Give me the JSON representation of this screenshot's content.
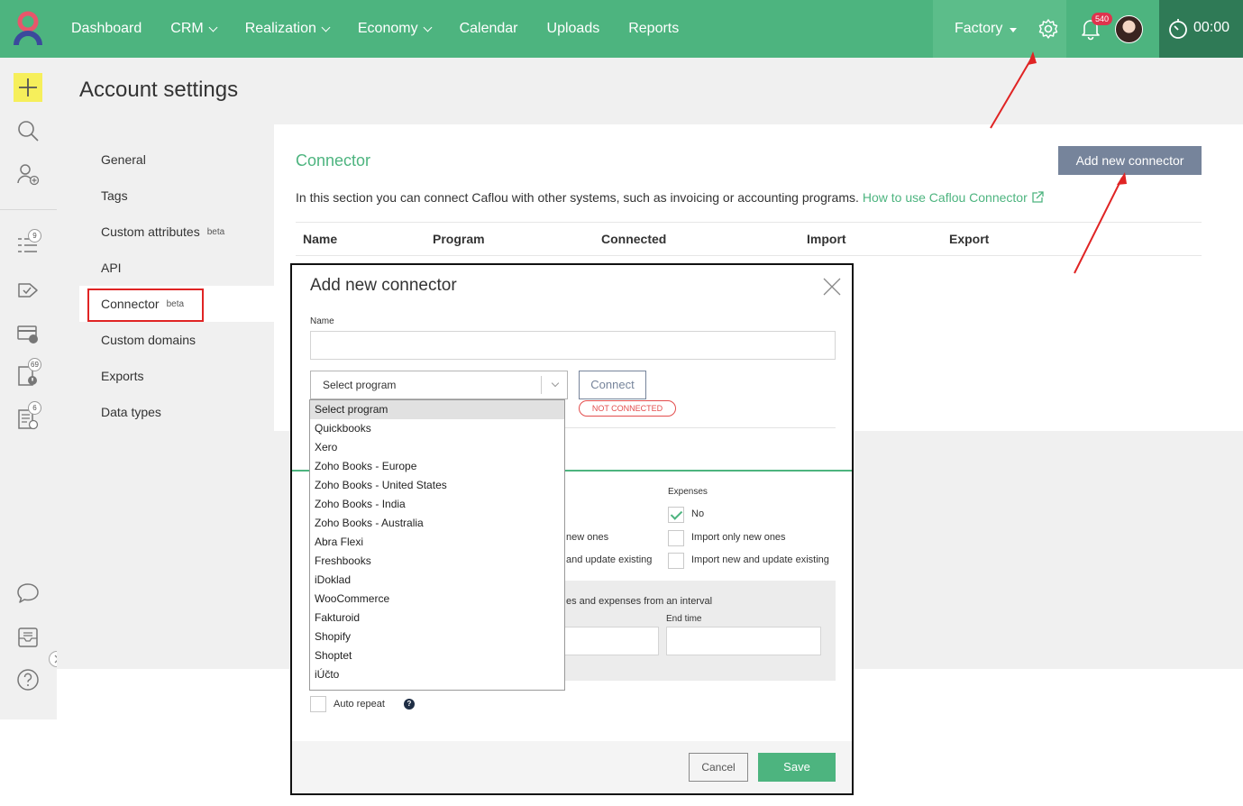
{
  "topbar": {
    "nav": [
      "Dashboard",
      "CRM",
      "Realization",
      "Economy",
      "Calendar",
      "Uploads",
      "Reports"
    ],
    "company": "Factory",
    "notifications": "540",
    "timer": "00:00"
  },
  "sidebar": {
    "badges": [
      "9",
      "69",
      "6"
    ]
  },
  "page": {
    "title": "Account settings"
  },
  "settings_nav": {
    "items": [
      {
        "label": "General"
      },
      {
        "label": "Tags"
      },
      {
        "label": "Custom attributes",
        "tag": "beta"
      },
      {
        "label": "API"
      },
      {
        "label": "Connector",
        "tag": "beta"
      },
      {
        "label": "Custom domains"
      },
      {
        "label": "Exports"
      },
      {
        "label": "Data types"
      }
    ]
  },
  "panel": {
    "title": "Connector",
    "add_button": "Add new connector",
    "description": "In this section you can connect Caflou with other systems, such as invoicing or accounting programs.",
    "link": "How to use Caflou Connector",
    "columns": [
      "Name",
      "Program",
      "Connected",
      "Import",
      "Export"
    ]
  },
  "modal": {
    "title": "Add new connector",
    "name_label": "Name",
    "name_value": "",
    "select_value": "Select program",
    "connect_button": "Connect",
    "status": "NOT CONNECTED",
    "expenses_label": "Expenses",
    "left_options": [
      "new ones",
      "and update existing"
    ],
    "expenses_options": [
      "No",
      "Import only new ones",
      "Import new and update existing"
    ],
    "interval_text": "es and expenses from an interval",
    "end_time_label": "End time",
    "auto_repeat": "Auto repeat",
    "help": "?",
    "cancel": "Cancel",
    "save": "Save"
  },
  "dropdown": {
    "options": [
      "Select program",
      "Quickbooks",
      "Xero",
      "Zoho Books - Europe",
      "Zoho Books - United States",
      "Zoho Books - India",
      "Zoho Books - Australia",
      "Abra Flexi",
      "Freshbooks",
      "iDoklad",
      "WooCommerce",
      "Fakturoid",
      "Shopify",
      "Shoptet",
      "iÚčto"
    ]
  },
  "colors": {
    "brand_green": "#4db47f",
    "dark_green": "#2f7a56",
    "button_gray": "#76849b",
    "alert_red": "#e02424"
  }
}
